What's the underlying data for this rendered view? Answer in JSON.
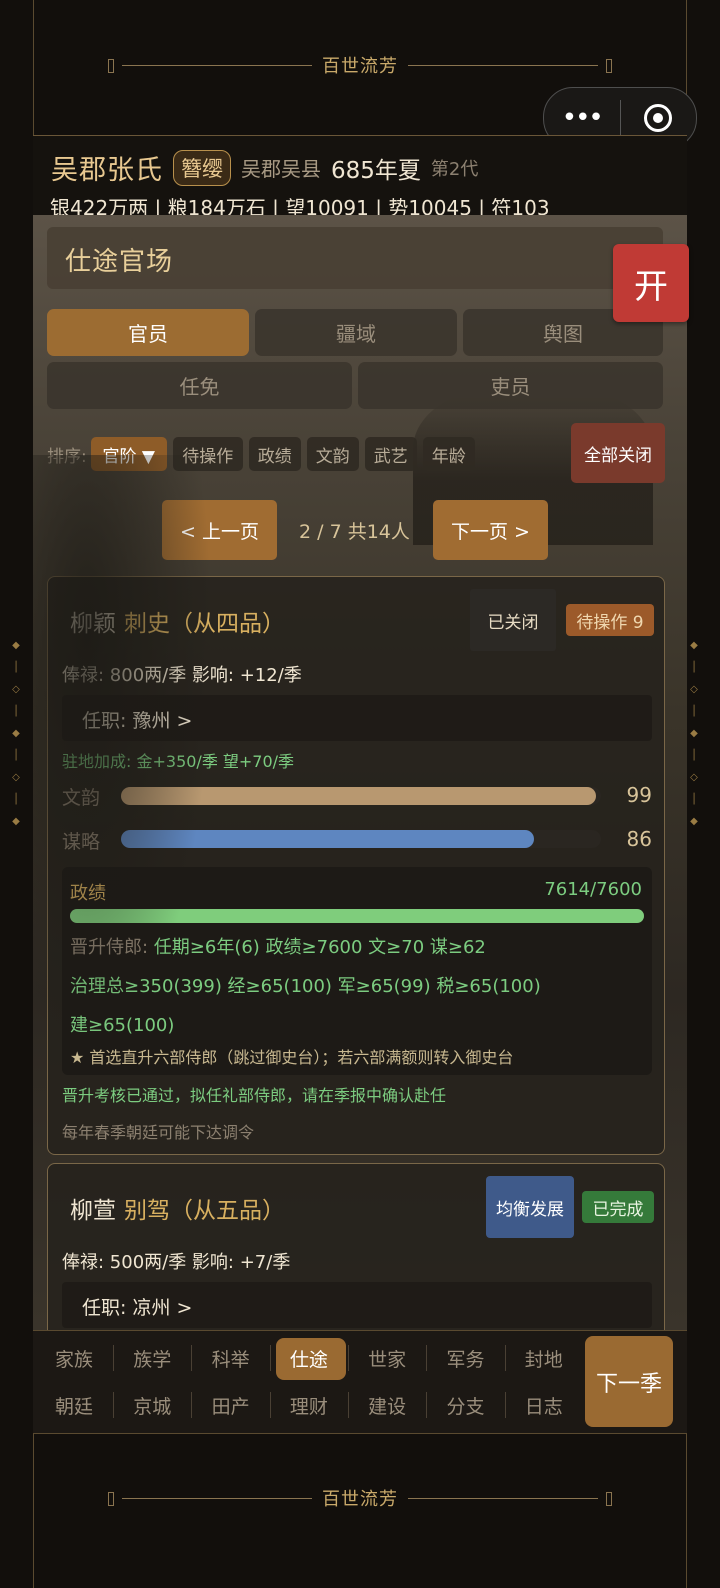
{
  "banner_title": "百世流芳",
  "capsule": {
    "menu_icon": "more-dots-icon",
    "close_icon": "target-icon"
  },
  "header": {
    "clan_name": "吴郡张氏",
    "rank_badge": "簪缨",
    "location": "吴郡吴县",
    "year": "685年夏",
    "generation": "第2代",
    "resources": "银422万两 | 粮184万石 | 望10091 | 势10045 | 符103"
  },
  "section_title": "仕途官场",
  "open_button": "开",
  "tabs": [
    {
      "label": "官员",
      "active": true
    },
    {
      "label": "疆域",
      "active": false
    },
    {
      "label": "舆图",
      "active": false
    },
    {
      "label": "任免",
      "active": false
    },
    {
      "label": "吏员",
      "active": false
    }
  ],
  "sort": {
    "label": "排序:",
    "options": [
      "官阶 ▼",
      "待操作",
      "政绩",
      "文韵",
      "武艺",
      "年龄"
    ],
    "close_all": "全部关闭"
  },
  "pagination": {
    "prev": "< 上一页",
    "info": "2 / 7  共14人",
    "next": "下一页 >"
  },
  "officials": [
    {
      "name": "柳颖",
      "title": "刺史（从四品）",
      "closed_tag": "已关闭",
      "pending_tag": "待操作 9",
      "salary": "俸禄: 800两/季   影响: +12/季",
      "office": "任职: 豫州  >",
      "bonus": "驻地加成: 金+350/季  望+70/季",
      "stats": [
        {
          "label": "文韵",
          "value": 99,
          "max": 100,
          "color": "#b89870"
        },
        {
          "label": "谋略",
          "value": 86,
          "max": 100,
          "color": "#5e86c0"
        }
      ],
      "performance": {
        "label": "政绩",
        "value_text": "7614/7600",
        "progress": 1.0,
        "promo_line1_prefix": "晋升侍郎: ",
        "promo_line1": "任期≥6年(6)  政绩≥7600  文≥70  谋≥62",
        "promo_line2": "治理总≥350(399)  经≥65(100)  军≥65(99)  税≥65(100)",
        "promo_line3": "建≥65(100)",
        "promo_note": "★ 首选直升六部侍郎（跳过御史台）；若六部满额则转入御史台"
      },
      "notice_green": "晋升考核已通过，拟任礼部侍郎，请在季报中确认赴任",
      "notice_gray": "每年春季朝廷可能下达调令"
    },
    {
      "name": "柳萱",
      "title": "别驾（从五品）",
      "strategy_tag": "均衡发展",
      "done_tag": "已完成",
      "salary": "俸禄: 500两/季   影响: +7/季",
      "office": "任职: 凉州  >"
    }
  ],
  "nav": {
    "row1": [
      "家族",
      "族学",
      "科举",
      "仕途",
      "世家",
      "军务",
      "封地"
    ],
    "row2": [
      "朝廷",
      "京城",
      "田产",
      "理财",
      "建设",
      "分支",
      "日志"
    ],
    "active": "仕途",
    "next_season": "下一季"
  }
}
